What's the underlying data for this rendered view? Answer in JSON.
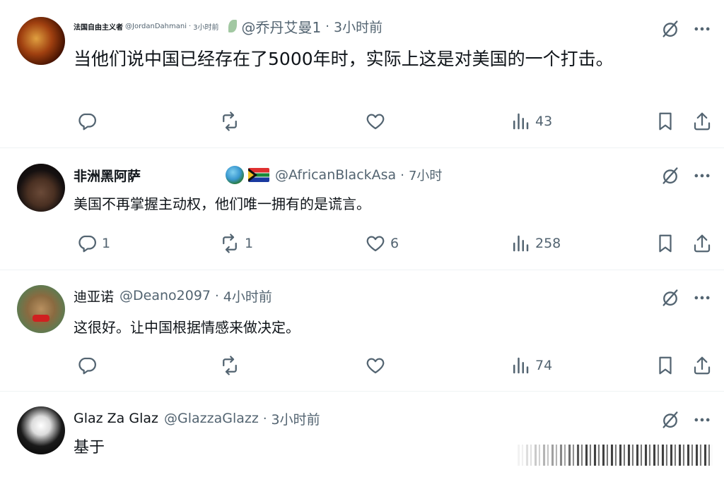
{
  "posts": [
    {
      "author": "法国自由主义者",
      "handle": "@JordanDahmani",
      "time": "3小时前",
      "quoted_handle": "@乔丹艾曼1",
      "quoted_time": "3小时前",
      "text": "当他们说中国已经存在了5000年时，实际上这是对美国的一个打击。",
      "reply_count": "",
      "repost_count": "",
      "like_count": "",
      "views": "43"
    },
    {
      "author": "非洲黑阿萨",
      "handle": "@AfricanBlackAsa",
      "time": "7小时",
      "text": "美国不再掌握主动权，他们唯一拥有的是谎言。",
      "reply_count": "1",
      "repost_count": "1",
      "like_count": "6",
      "views": "258"
    },
    {
      "author": "迪亚诺",
      "handle": "@Deano2097",
      "time": "4小时前",
      "text": "这很好。让中国根据情感来做决定。",
      "reply_count": "",
      "repost_count": "",
      "like_count": "",
      "views": "74"
    },
    {
      "author": "Glaz Za Glaz",
      "handle": "@GlazzaGlazz",
      "time": "3小时前",
      "text": "基于"
    }
  ],
  "separator": "·",
  "icons": {
    "reply": "reply-icon",
    "repost": "repost-icon",
    "like": "heart-icon",
    "views": "views-icon",
    "bookmark": "bookmark-icon",
    "share": "share-icon",
    "grok": "grok-icon",
    "more": "more-icon"
  }
}
